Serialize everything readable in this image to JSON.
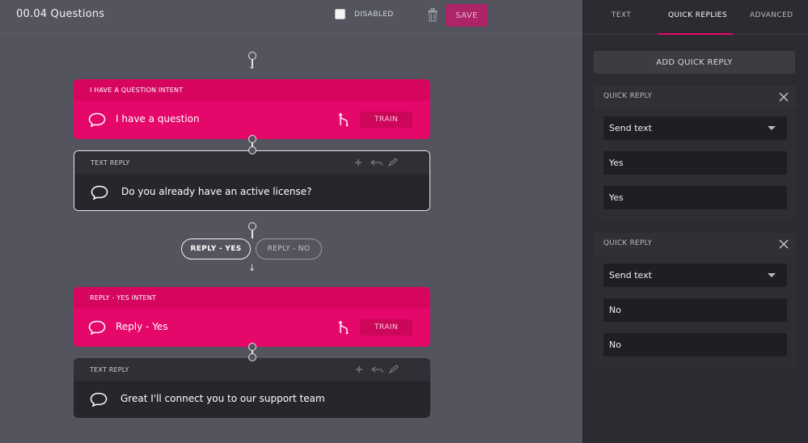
{
  "topbar": {
    "title": "00.04 Questions",
    "disabled_label": "DISABLED",
    "save_label": "SAVE"
  },
  "cards": {
    "intent1": {
      "header": "I HAVE A QUESTION INTENT",
      "text": "I have a question",
      "train_label": "TRAIN"
    },
    "reply1": {
      "header": "TEXT REPLY",
      "text": "Do you already have an active license?"
    },
    "intent2": {
      "header": "REPLY - YES INTENT",
      "text": "Reply - Yes",
      "train_label": "TRAIN"
    },
    "reply2": {
      "header": "TEXT REPLY",
      "text": "Great I'll connect you to our support team"
    }
  },
  "chips": {
    "yes": "REPLY - YES",
    "no": "REPLY - NO"
  },
  "panel": {
    "tabs": [
      "TEXT",
      "QUICK REPLIES",
      "ADVANCED"
    ],
    "active_tab": "QUICK REPLIES",
    "add_label": "ADD QUICK REPLY",
    "sections": [
      {
        "title": "QUICK REPLY",
        "action": "Send text",
        "title_value": "Yes",
        "payload": "Yes"
      },
      {
        "title": "QUICK REPLY",
        "action": "Send text",
        "title_value": "No",
        "payload": "No"
      }
    ]
  },
  "colors": {
    "accent": "#e6076a",
    "save_button": "#ad2467",
    "canvas": "#53545d",
    "panel": "#2b2c31"
  },
  "icons": [
    "trash-icon",
    "speech-bubble-icon",
    "branch-icon",
    "close-icon",
    "chevron-down-icon",
    "arrow-down-icon"
  ]
}
